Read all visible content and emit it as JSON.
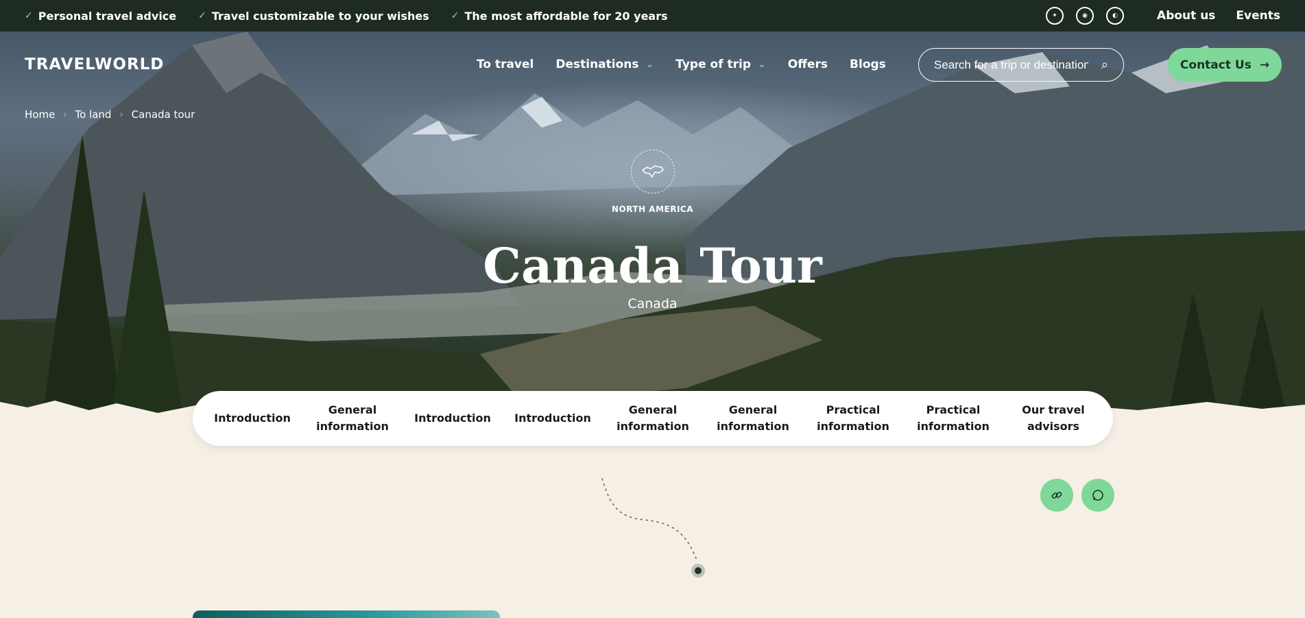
{
  "topbar": {
    "usps": [
      "Personal travel advice",
      "Travel customizable to your wishes",
      "The most affordable for 20 years"
    ],
    "links": [
      "About us",
      "Events"
    ]
  },
  "header": {
    "logo": "TRAVELWORLD",
    "nav": [
      "To travel",
      "Destinations",
      "Type of trip",
      "Offers",
      "Blogs"
    ],
    "search_placeholder": "Search for a trip or destination",
    "contact_label": "Contact Us"
  },
  "breadcrumb": [
    "Home",
    "To land",
    "Canada tour"
  ],
  "hero": {
    "region": "NORTH AMERICA",
    "title": "Canada Tour",
    "subtitle": "Canada"
  },
  "tabs": [
    "Introduction",
    "General information",
    "Introduction",
    "Introduction",
    "General information",
    "General information",
    "Practical information",
    "Practical information",
    "Our travel advisors"
  ],
  "colors": {
    "accent": "#7fd89a",
    "topbar": "#1e2b22",
    "page_bg": "#f5efe6"
  }
}
